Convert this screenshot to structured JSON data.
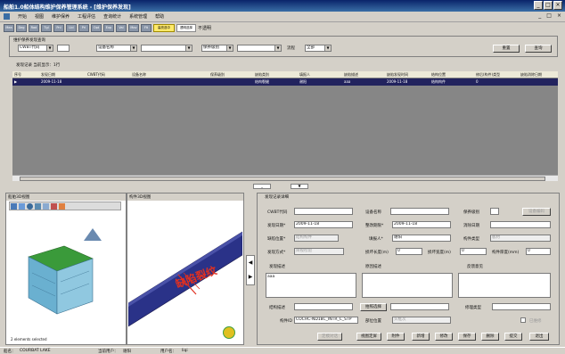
{
  "window": {
    "title": "船舶1.0船体结构维护保养管理系统 - [维护保养发现]",
    "controls": [
      "_",
      "□",
      "×"
    ]
  },
  "menu": {
    "items": [
      "开始",
      "视图",
      "维护保养",
      "工程评估",
      "查询统计",
      "系统管理",
      "帮助"
    ],
    "right_controls": [
      "_",
      "□",
      "×"
    ]
  },
  "toolbar": {
    "buttons": [
      "Mea",
      "Deg",
      "Rad",
      "Tgl",
      "Pnl",
      "Lbl",
      "Pri",
      "Opt",
      "Exp",
      "Val",
      "Mov",
      "Fit"
    ],
    "highlight_label": "高亮选中",
    "transparency_label": "透明选择",
    "transparency_value": "不透明"
  },
  "query": {
    "group_title": "维护保养发现查询",
    "field1": "CWBT代码",
    "field2_label": "设备名称",
    "field3": "保养级别",
    "status_label": "流程",
    "status_value": "全部",
    "reset_label": "重置",
    "search_label": "查询"
  },
  "records": {
    "summary": "发现记录 当前显示：1行",
    "columns": [
      "序号",
      "发现日期",
      "CWBT代码",
      "设备名称",
      "保养级别",
      "缺陷类别",
      "填报人",
      "缺陷描述",
      "缺陷发现时间",
      "结构位置",
      "修后(构件)类型",
      "缺陷消除日期"
    ],
    "rows": [
      [
        "▶",
        "2009-11-18",
        "",
        "",
        "",
        "结构裂缝",
        "谢阳",
        "aaa",
        "2009-11-18",
        "结构构件",
        "0",
        ""
      ]
    ]
  },
  "viewer3d": {
    "title": "船舶3D视图",
    "selected_count": "2 elements selected"
  },
  "component_view": {
    "title": "构件3D视图",
    "annotation": "缺陷裂纹"
  },
  "detail": {
    "title": "发现记录详细",
    "cwbt_label": "CWBT代码",
    "device_label": "设备名称",
    "level_label": "保养级别",
    "device_code_btn": "设备编码",
    "found_date_label": "发现日期*",
    "found_date": "2009-11-18",
    "rectify_date_label": "整改期限*",
    "rectify_date": "2009-11-18",
    "close_date_label": "消除日期",
    "defect_location_label": "缺陷位置*",
    "defect_location": "结构构件",
    "reporter_label": "填报人*",
    "reporter": "谢阳",
    "component_type_label": "构件类型",
    "component_type": "板材",
    "found_way_label": "发现方式*",
    "found_way": "目视检验",
    "defect_len_label": "损坏长度(m)",
    "defect_len": "0",
    "defect_width_label": "损坏宽度(m)",
    "defect_width": "0",
    "thickness_label": "构件厚度(mm)",
    "thickness": "0",
    "desc_label": "发现描述",
    "desc_value": "aaa",
    "cause_label": "原因描述",
    "opinion_label": "反馈意见",
    "struct_label": "结构描述",
    "photo_btn": "拍照选择",
    "repair_type_label": "修理类型",
    "component_id_label": "构件ID",
    "component_id": "COCHC-ND18C_INTR_C_STP",
    "part_pos_label": "部位位置",
    "part_pos": "头框次",
    "completed_label": "已维修",
    "buttons": [
      "定模对话",
      "视图定屏",
      "附件",
      "新增",
      "修改",
      "保存",
      "删除",
      "提交",
      "退出"
    ]
  },
  "status": {
    "site_label": "船名：",
    "site_value": "COURBAT LAKE",
    "user_label": "当前用户：",
    "user_value": "谢阳",
    "role_label": "用户名：",
    "role_value": "liqi"
  }
}
